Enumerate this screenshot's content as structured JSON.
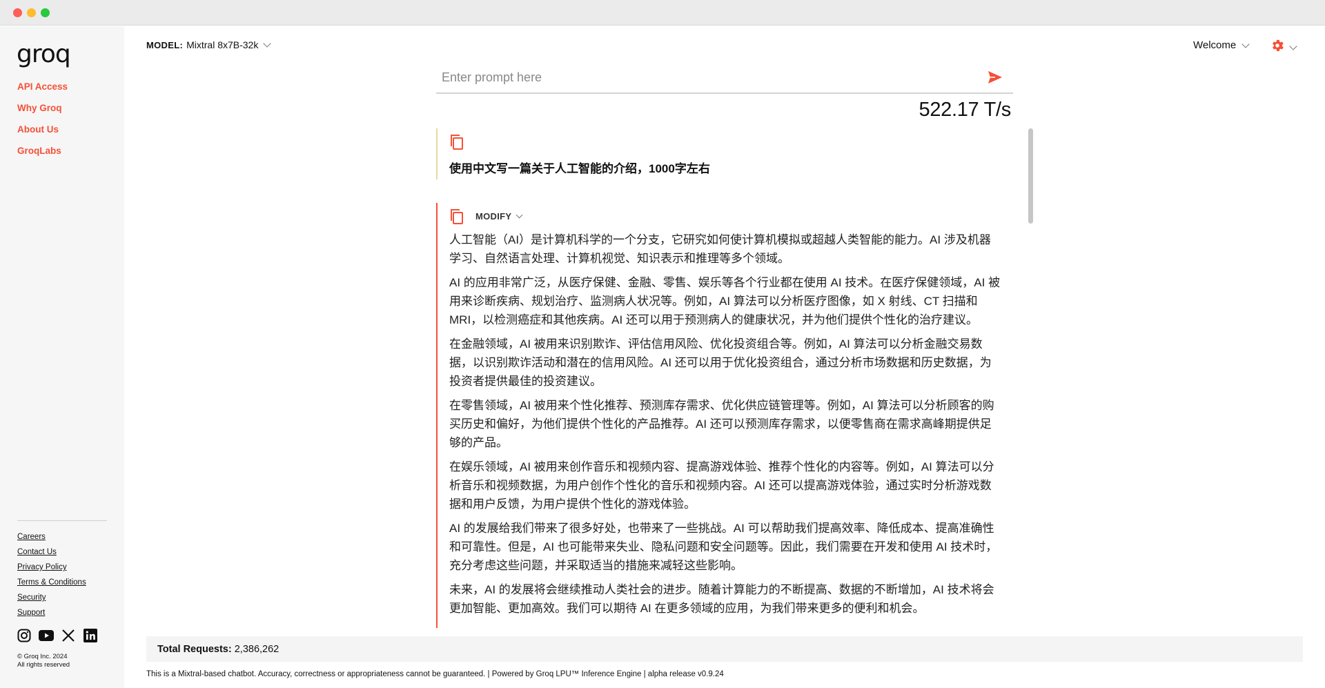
{
  "sidebar": {
    "logo": "groq",
    "nav": [
      {
        "label": "API Access"
      },
      {
        "label": "Why Groq"
      },
      {
        "label": "About Us"
      },
      {
        "label": "GroqLabs"
      }
    ],
    "footer_links": [
      {
        "label": "Careers"
      },
      {
        "label": "Contact Us"
      },
      {
        "label": "Privacy Policy"
      },
      {
        "label": "Terms & Conditions"
      },
      {
        "label": "Security"
      },
      {
        "label": "Support"
      }
    ],
    "socials": [
      "instagram-icon",
      "youtube-icon",
      "x-icon",
      "linkedin-icon"
    ],
    "copyright_line1": "© Groq Inc. 2024",
    "copyright_line2": "All rights reserved"
  },
  "header": {
    "model_label": "MODEL:",
    "model_value": "Mixtral 8x7B-32k",
    "welcome": "Welcome"
  },
  "prompt": {
    "placeholder": "Enter prompt here",
    "value": ""
  },
  "speed": "522.17 T/s",
  "messages": {
    "user_text": "使用中文写一篇关于人工智能的介绍，1000字左右",
    "modify_label": "MODIFY",
    "ai_paragraphs": [
      "人工智能（AI）是计算机科学的一个分支，它研究如何使计算机模拟或超越人类智能的能力。AI 涉及机器学习、自然语言处理、计算机视觉、知识表示和推理等多个领域。",
      "AI 的应用非常广泛，从医疗保健、金融、零售、娱乐等各个行业都在使用 AI 技术。在医疗保健领域，AI 被用来诊断疾病、规划治疗、监测病人状况等。例如，AI 算法可以分析医疗图像，如 X 射线、CT 扫描和 MRI，以检测癌症和其他疾病。AI 还可以用于预测病人的健康状况，并为他们提供个性化的治疗建议。",
      "在金融领域，AI 被用来识别欺诈、评估信用风险、优化投资组合等。例如，AI 算法可以分析金融交易数据，以识别欺诈活动和潜在的信用风险。AI 还可以用于优化投资组合，通过分析市场数据和历史数据，为投资者提供最佳的投资建议。",
      "在零售领域，AI 被用来个性化推荐、预测库存需求、优化供应链管理等。例如，AI 算法可以分析顾客的购买历史和偏好，为他们提供个性化的产品推荐。AI 还可以预测库存需求，以便零售商在需求高峰期提供足够的产品。",
      "在娱乐领域，AI 被用来创作音乐和视频内容、提高游戏体验、推荐个性化的内容等。例如，AI 算法可以分析音乐和视频数据，为用户创作个性化的音乐和视频内容。AI 还可以提高游戏体验，通过实时分析游戏数据和用户反馈，为用户提供个性化的游戏体验。",
      "AI 的发展给我们带来了很多好处，也带来了一些挑战。AI 可以帮助我们提高效率、降低成本、提高准确性和可靠性。但是，AI 也可能带来失业、隐私问题和安全问题等。因此，我们需要在开发和使用 AI 技术时，充分考虑这些问题，并采取适当的措施来减轻这些影响。",
      "未来，AI 的发展将会继续推动人类社会的进步。随着计算能力的不断提高、数据的不断增加，AI 技术将会更加智能、更加高效。我们可以期待 AI 在更多领域的应用，为我们带来更多的便利和机会。"
    ]
  },
  "footer": {
    "total_label": "Total Requests:",
    "total_value": "2,386,262",
    "disclaimer": "This is a Mixtral-based chatbot. Accuracy, correctness or appropriateness cannot be guaranteed. | Powered by Groq LPU™ Inference Engine | alpha release v0.9.24"
  },
  "colors": {
    "accent": "#f55036",
    "user_border": "#e9d9a0"
  }
}
